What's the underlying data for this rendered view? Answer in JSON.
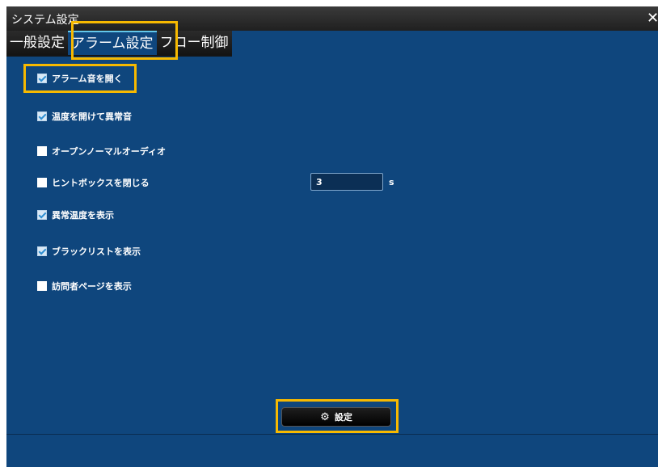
{
  "window": {
    "title": "システム設定"
  },
  "tabs": [
    {
      "label": "一般設定",
      "active": false
    },
    {
      "label": "アラーム設定",
      "active": true
    },
    {
      "label": "フロー制御",
      "active": false
    }
  ],
  "options": [
    {
      "label": "アラーム音を開く",
      "checked": true
    },
    {
      "label": "温度を開けて異常音",
      "checked": true
    },
    {
      "label": "オープンノーマルオーディオ",
      "checked": false
    },
    {
      "label": "ヒントボックスを閉じる",
      "checked": false
    },
    {
      "label": "異常温度を表示",
      "checked": true
    },
    {
      "label": "ブラックリストを表示",
      "checked": true
    },
    {
      "label": "訪問者ページを表示",
      "checked": false
    }
  ],
  "hint_box": {
    "value": "3",
    "unit": "s"
  },
  "submit": {
    "label": "設定",
    "icon": "gear-icon"
  },
  "colors": {
    "panel": "#0f467d",
    "titlebar": "#2a2a2a",
    "highlight": "#f7b900",
    "tab_accent": "#62c7ea"
  }
}
